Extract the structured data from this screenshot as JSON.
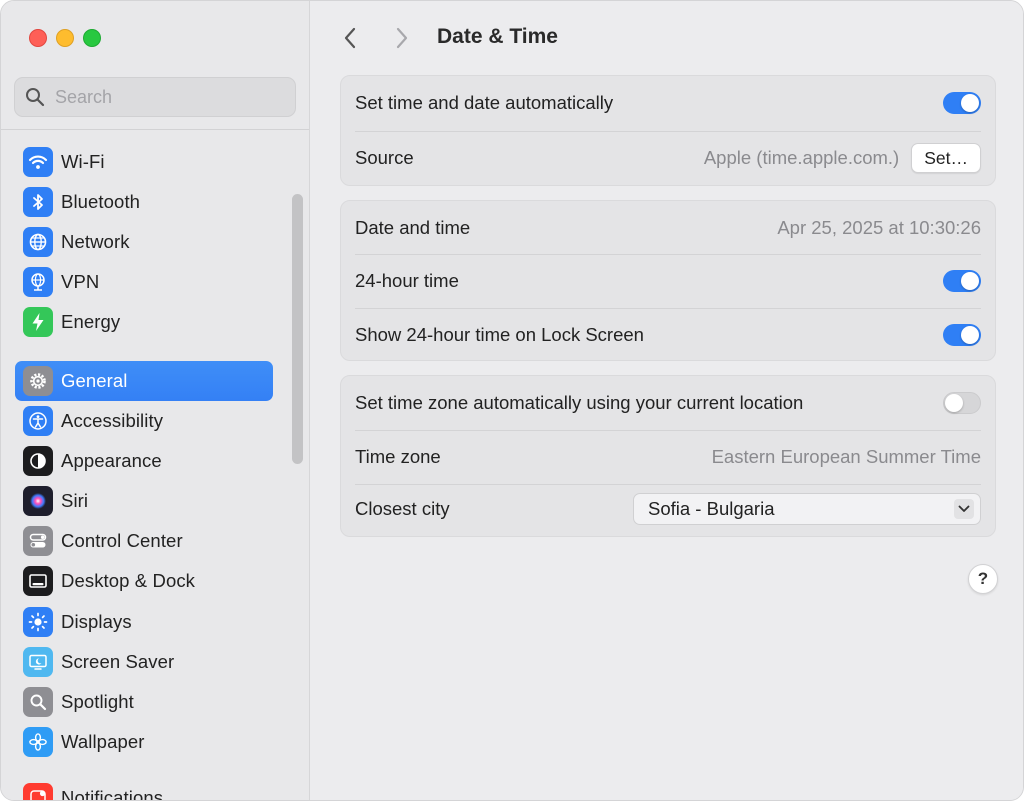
{
  "window": {
    "traffic_lights": [
      "close",
      "minimize",
      "zoom"
    ]
  },
  "sidebar": {
    "search_placeholder": "Search",
    "items": [
      {
        "label": "Wi-Fi",
        "icon": "wifi-icon",
        "color": "#2f7ff5"
      },
      {
        "label": "Bluetooth",
        "icon": "bluetooth-icon",
        "color": "#2f7ff5"
      },
      {
        "label": "Network",
        "icon": "globe-icon",
        "color": "#2f7ff5"
      },
      {
        "label": "VPN",
        "icon": "vpn-globe-icon",
        "color": "#2f7ff5"
      },
      {
        "label": "Energy",
        "icon": "bolt-icon",
        "color": "#34c759"
      },
      {
        "label": "General",
        "icon": "gear-icon",
        "color": "#8e8e93",
        "active": true
      },
      {
        "label": "Accessibility",
        "icon": "accessibility-icon",
        "color": "#2f7ff5"
      },
      {
        "label": "Appearance",
        "icon": "appearance-icon",
        "color": "#1c1c1e"
      },
      {
        "label": "Siri",
        "icon": "siri-icon",
        "color": "#2a2a3a"
      },
      {
        "label": "Control Center",
        "icon": "control-center-icon",
        "color": "#8e8e93"
      },
      {
        "label": "Desktop & Dock",
        "icon": "dock-icon",
        "color": "#1c1c1e"
      },
      {
        "label": "Displays",
        "icon": "sun-icon",
        "color": "#2f7ff5"
      },
      {
        "label": "Screen Saver",
        "icon": "screensaver-icon",
        "color": "#5ac8fa"
      },
      {
        "label": "Spotlight",
        "icon": "magnifier-icon",
        "color": "#8e8e93"
      },
      {
        "label": "Wallpaper",
        "icon": "flower-icon",
        "color": "#2f9cf5"
      },
      {
        "label": "Notifications",
        "icon": "bell-icon",
        "color": "#ff3b30"
      }
    ]
  },
  "toolbar": {
    "title": "Date & Time"
  },
  "groups": {
    "auto": {
      "set_auto_label": "Set time and date automatically",
      "set_auto_on": true,
      "source_label": "Source",
      "source_value": "Apple (time.apple.com.)",
      "set_button": "Set…"
    },
    "time": {
      "datetime_label": "Date and time",
      "datetime_value": "Apr 25, 2025 at 10:30:26",
      "h24_label": "24-hour time",
      "h24_on": true,
      "lock_label": "Show 24-hour time on Lock Screen",
      "lock_on": true
    },
    "zone": {
      "auto_zone_label": "Set time zone automatically using your current location",
      "auto_zone_on": false,
      "timezone_label": "Time zone",
      "timezone_value": "Eastern European Summer Time",
      "city_label": "Closest city",
      "city_value": "Sofia - Bulgaria"
    }
  },
  "help": "?"
}
